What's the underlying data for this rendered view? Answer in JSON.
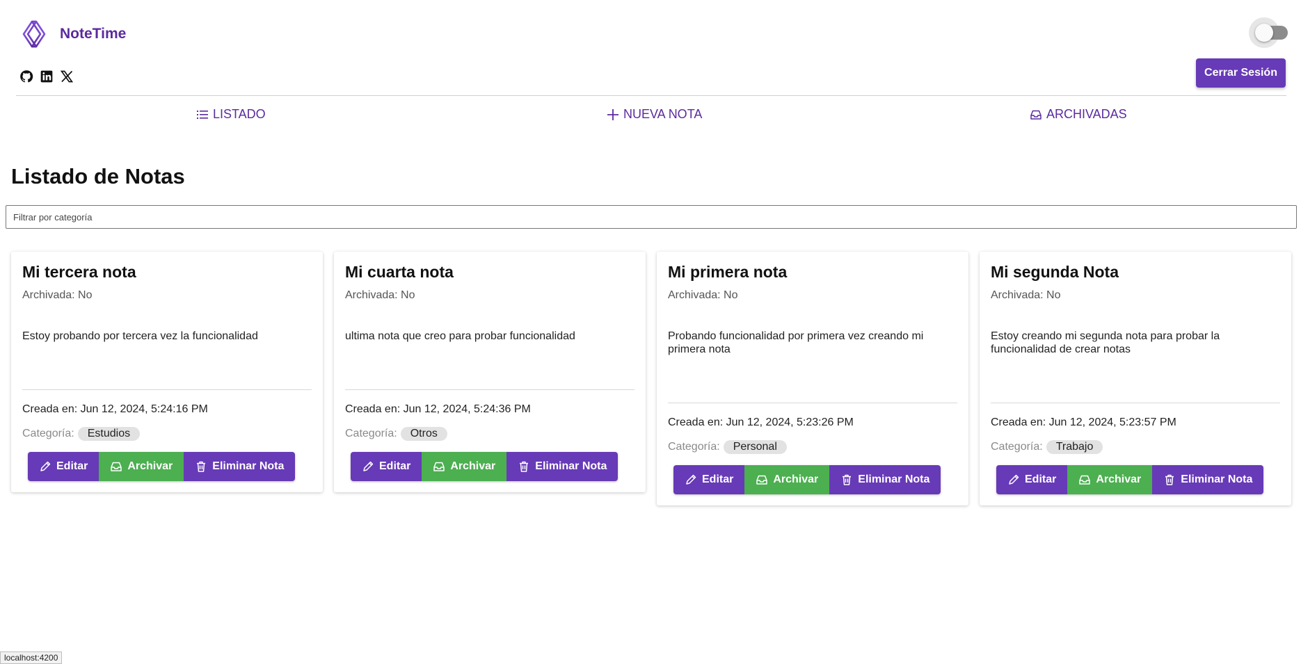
{
  "app": {
    "name": "NoteTime"
  },
  "header": {
    "socials": [
      "github-icon",
      "linkedin-icon",
      "x-icon"
    ],
    "logout_label": "Cerrar Sesión"
  },
  "nav": {
    "list_label": "LISTADO",
    "new_label": "NUEVA NOTA",
    "archived_label": "ARCHIVADAS"
  },
  "main": {
    "title": "Listado de Notas",
    "filter_placeholder": "Filtrar por categoría"
  },
  "notes": [
    {
      "title": "Mi tercera nota",
      "archived": "Archivada: No",
      "content": "Estoy probando por tercera vez la funcionalidad",
      "created": "Creada en: Jun 12, 2024, 5:24:16 PM",
      "category_label": "Categoría:",
      "category": "Estudios",
      "edit": "Editar",
      "archive": "Archivar",
      "delete": "Eliminar Nota"
    },
    {
      "title": "Mi cuarta nota",
      "archived": "Archivada: No",
      "content": "ultima nota que creo para probar funcionalidad",
      "created": "Creada en: Jun 12, 2024, 5:24:36 PM",
      "category_label": "Categoría:",
      "category": "Otros",
      "edit": "Editar",
      "archive": "Archivar",
      "delete": "Eliminar Nota"
    },
    {
      "title": "Mi primera nota",
      "archived": "Archivada: No",
      "content": "Probando funcionalidad por primera vez creando mi primera nota",
      "created": "Creada en: Jun 12, 2024, 5:23:26 PM",
      "category_label": "Categoría:",
      "category": "Personal",
      "edit": "Editar",
      "archive": "Archivar",
      "delete": "Eliminar Nota"
    },
    {
      "title": "Mi segunda Nota",
      "archived": "Archivada: No",
      "content": "Estoy creando mi segunda nota para probar la funcionalidad de crear notas",
      "created": "Creada en: Jun 12, 2024, 5:23:57 PM",
      "category_label": "Categoría:",
      "category": "Trabajo",
      "edit": "Editar",
      "archive": "Archivar",
      "delete": "Eliminar Nota"
    }
  ],
  "status_bar": {
    "url": "localhost:4200"
  },
  "colors": {
    "primary": "#673ab7",
    "brand_text": "#5b2a9e",
    "archive": "#4caf50"
  }
}
